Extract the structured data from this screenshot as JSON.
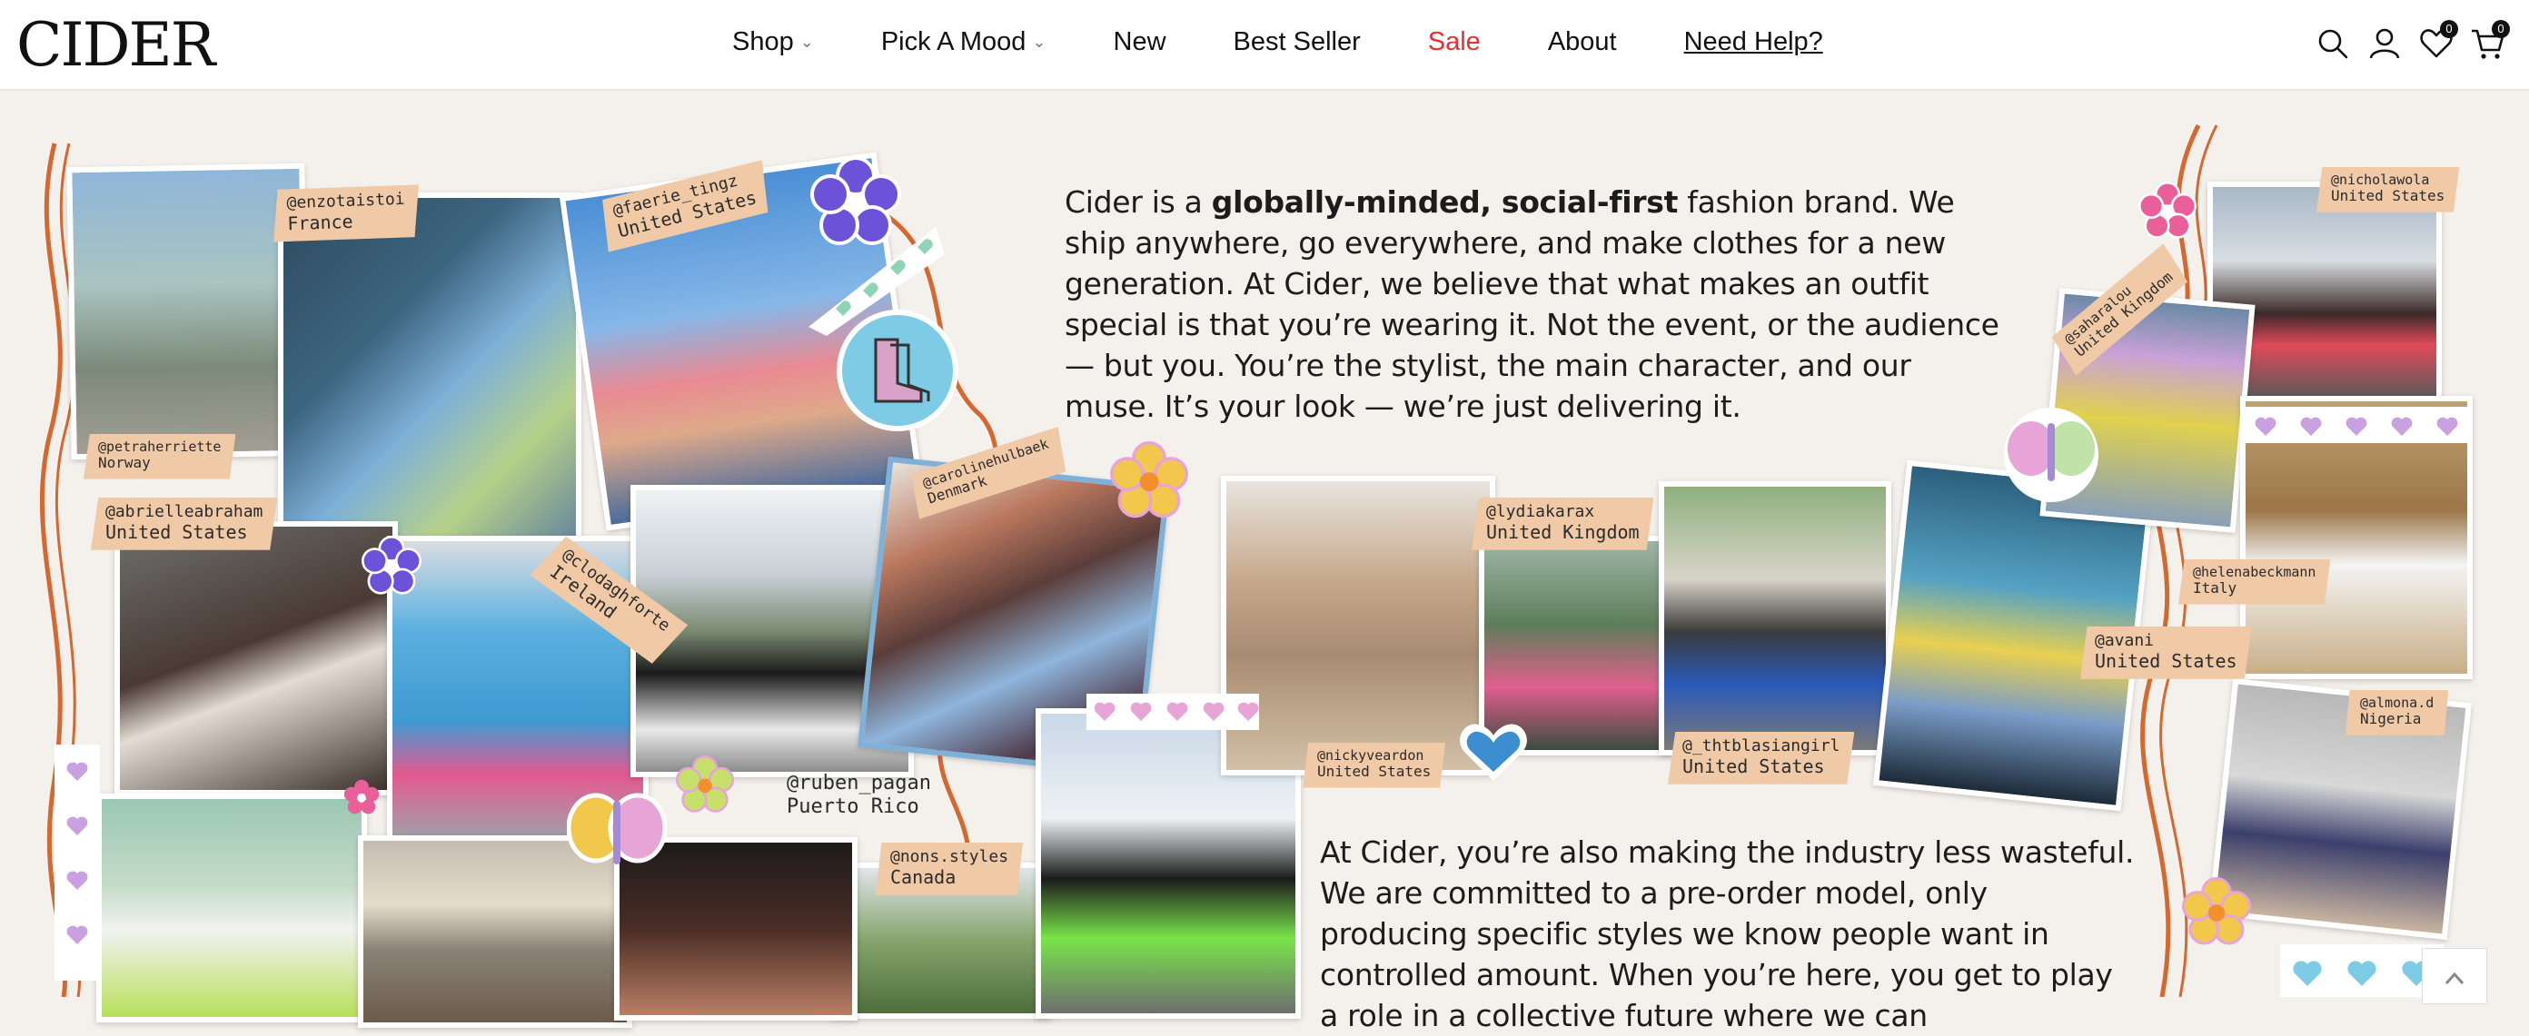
{
  "header": {
    "logo": "CIDER",
    "nav": [
      {
        "label": "Shop",
        "dropdown": true
      },
      {
        "label": "Pick A Mood",
        "dropdown": true
      },
      {
        "label": "New"
      },
      {
        "label": "Best Seller"
      },
      {
        "label": "Sale",
        "color": "#e53030"
      },
      {
        "label": "About"
      },
      {
        "label": "Need Help?"
      }
    ],
    "icons": [
      "search-icon",
      "account-icon",
      "wishlist-icon",
      "cart-icon"
    ],
    "wishlist_count": "0",
    "cart_count": "0"
  },
  "intro": {
    "before": "Cider is a ",
    "bold": "globally-minded, social-first",
    "after": " fashion brand. We ship anywhere, go everywhere, and make clothes for a new generation. At Cider, we believe that what makes an outfit special is that you’re wearing it. Not the event, or the audience — but you. You’re the stylist, the main character, and our muse. It’s your look — we’re just delivering it."
  },
  "second": {
    "text": "At Cider, you’re also making the industry less wasteful. We are committed to a pre-order model, only producing specific styles we know people want in controlled amount. When you’re here, you get to play a role in a collective future where we can"
  },
  "tags": [
    {
      "handle": "@enzotaistoi",
      "country": "France"
    },
    {
      "handle": "@faerie_tingz",
      "country": "United States"
    },
    {
      "handle": "@petraherriette",
      "country": "Norway"
    },
    {
      "handle": "@abrielleabraham",
      "country": "United States"
    },
    {
      "handle": "@clodaghforte",
      "country": "Ireland"
    },
    {
      "handle": "@carolinehulbaek",
      "country": "Denmark"
    },
    {
      "handle": "@ruben_pagan",
      "country": "Puerto Rico"
    },
    {
      "handle": "@nons.styles",
      "country": "Canada"
    },
    {
      "handle": "@lydiakarax",
      "country": "United Kingdom"
    },
    {
      "handle": "@nickyveardon",
      "country": "United States"
    },
    {
      "handle": "@_thtblasiangirl",
      "country": "United States"
    },
    {
      "handle": "@nicholawola",
      "country": "United States"
    },
    {
      "handle": "@saharalou",
      "country": "United Kingdom"
    },
    {
      "handle": "@helenabeckmann",
      "country": "Italy"
    },
    {
      "handle": "@avani",
      "country": "United States"
    },
    {
      "handle": "@almona.d",
      "country": "Nigeria"
    }
  ],
  "colors": {
    "background": "#f4f0ec",
    "tag": "#f0c9a6",
    "sale": "#e53030",
    "swirl": "#d5672f",
    "flower_purple": "#6b52d9",
    "flower_yellow": "#f1c84b",
    "flower_pink": "#e95f9a"
  }
}
